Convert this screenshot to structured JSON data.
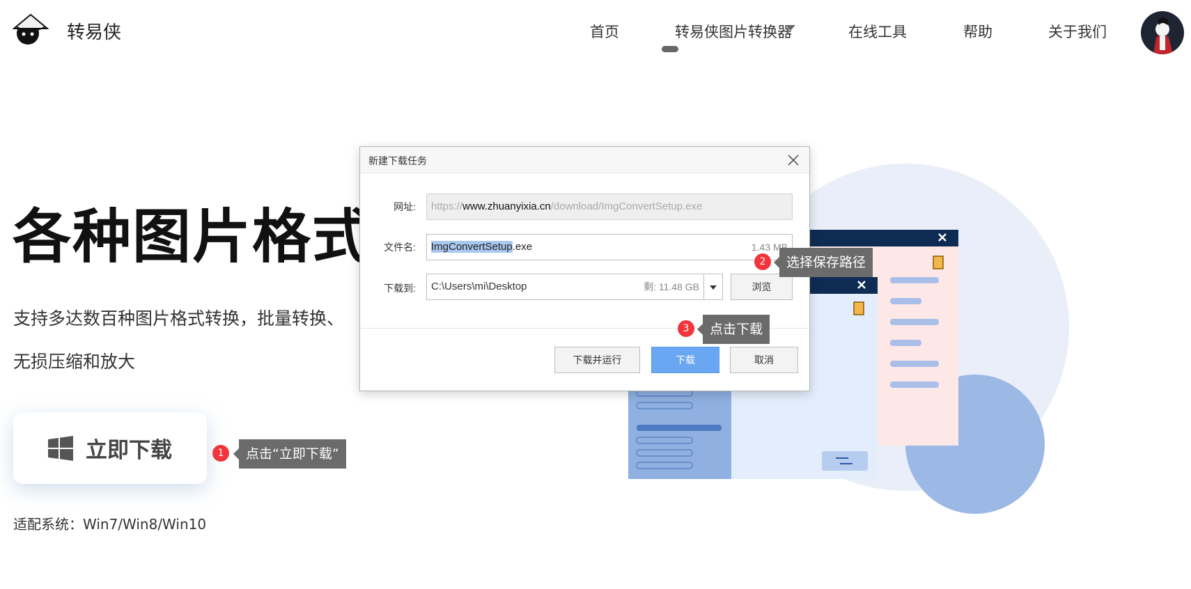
{
  "header": {
    "brand": "转易侠",
    "nav": [
      "首页",
      "转易侠图片转换器",
      "在线工具",
      "帮助",
      "关于我们"
    ]
  },
  "hero": {
    "title": "各种图片格式转",
    "desc_line1": "支持多达数百种图片格式转换，批量转换、",
    "desc_line2": "无损压缩和放大",
    "download_button": "立即下载",
    "compat_label": "适配系统：Win7/Win8/Win10"
  },
  "callouts": [
    {
      "num": "1",
      "text": "点击“立即下载”"
    },
    {
      "num": "2",
      "text": "选择保存路径"
    },
    {
      "num": "3",
      "text": "点击下载"
    }
  ],
  "dialog": {
    "title": "新建下载任务",
    "url_label": "网址:",
    "url_prefix": "https://",
    "url_host": "www.zhuanyixia.cn",
    "url_path": "/download/ImgConvertSetup.exe",
    "filename_label": "文件名:",
    "filename_selected": "ImgConvertSetup",
    "filename_ext": ".exe",
    "file_size": "1.43 MB",
    "saveto_label": "下载到:",
    "save_path": "C:\\Users\\mi\\Desktop",
    "free_space": "剩: 11.48 GB",
    "browse_button": "浏览",
    "download_run_button": "下载并运行",
    "download_button": "下载",
    "cancel_button": "取消"
  },
  "colors": {
    "accent_blue": "#6aa7f2",
    "badge_red": "#f2353b",
    "tooltip_gray": "#6b6b6b"
  }
}
